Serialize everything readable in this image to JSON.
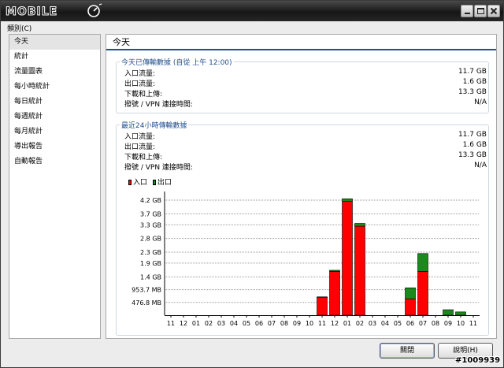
{
  "window": {
    "app_name": "MOBILE"
  },
  "menu": {
    "category": "類別(C)"
  },
  "sidebar": {
    "items": [
      {
        "label": "今天",
        "active": true
      },
      {
        "label": "統計"
      },
      {
        "label": "流量圖表"
      },
      {
        "label": "每小時統計"
      },
      {
        "label": "每日統計"
      },
      {
        "label": "每週統計"
      },
      {
        "label": "每月統計"
      },
      {
        "label": "導出報告"
      },
      {
        "label": "自動報告"
      }
    ]
  },
  "main": {
    "title": "今天",
    "today_group": {
      "title": "今天已傳輸數據 (自從 上午 12:00)",
      "rows": [
        {
          "label": "入口流量:",
          "value": "11.7 GB"
        },
        {
          "label": "出口流量:",
          "value": "1.6 GB"
        },
        {
          "label": "下載和上傳:",
          "value": "13.3 GB"
        },
        {
          "label": "撥號 / VPN 連接時間:",
          "value": "N/A"
        }
      ]
    },
    "last24_group": {
      "title": "最近24小時傳輸數據",
      "rows": [
        {
          "label": "入口流量:",
          "value": "11.7 GB"
        },
        {
          "label": "出口流量:",
          "value": "1.6 GB"
        },
        {
          "label": "下載和上傳:",
          "value": "13.3 GB"
        },
        {
          "label": "撥號 / VPN 連接時間:",
          "value": "N/A"
        }
      ]
    },
    "legend": {
      "in_label": "入口",
      "out_label": "出口"
    }
  },
  "chart_data": {
    "type": "bar",
    "stacked": true,
    "categories": [
      "11",
      "12",
      "01",
      "02",
      "03",
      "04",
      "05",
      "06",
      "07",
      "08",
      "09",
      "10",
      "11",
      "12",
      "01",
      "02",
      "03",
      "04",
      "05",
      "06",
      "07",
      "08",
      "09",
      "10",
      "11"
    ],
    "series": [
      {
        "name": "入口",
        "color": "#ff0000",
        "values": [
          0,
          0,
          0,
          0,
          0,
          0,
          0,
          0,
          0,
          0,
          0,
          0,
          0.65,
          1.6,
          4.15,
          3.25,
          0,
          0,
          0,
          0.6,
          1.6,
          0,
          0,
          0,
          0
        ]
      },
      {
        "name": "出口",
        "color": "#1a8a1a",
        "values": [
          0,
          0,
          0,
          0,
          0,
          0,
          0,
          0,
          0,
          0,
          0,
          0,
          0.02,
          0.04,
          0.1,
          0.1,
          0,
          0,
          0,
          0.4,
          0.65,
          0,
          0.2,
          0.12,
          0
        ]
      }
    ],
    "y_ticks": [
      "476.8 MB",
      "953.7 MB",
      "1.4 GB",
      "1.9 GB",
      "2.3 GB",
      "2.8 GB",
      "3.3 GB",
      "3.7 GB",
      "4.2 GB"
    ],
    "y_tick_values": [
      0.4656,
      0.9313,
      1.4,
      1.9,
      2.3,
      2.8,
      3.3,
      3.7,
      4.2
    ],
    "ylim": [
      0,
      4.4
    ],
    "grid": true
  },
  "footer": {
    "close_label": "關閉",
    "help_label": "說明(H)"
  },
  "watermark": "#1009939"
}
